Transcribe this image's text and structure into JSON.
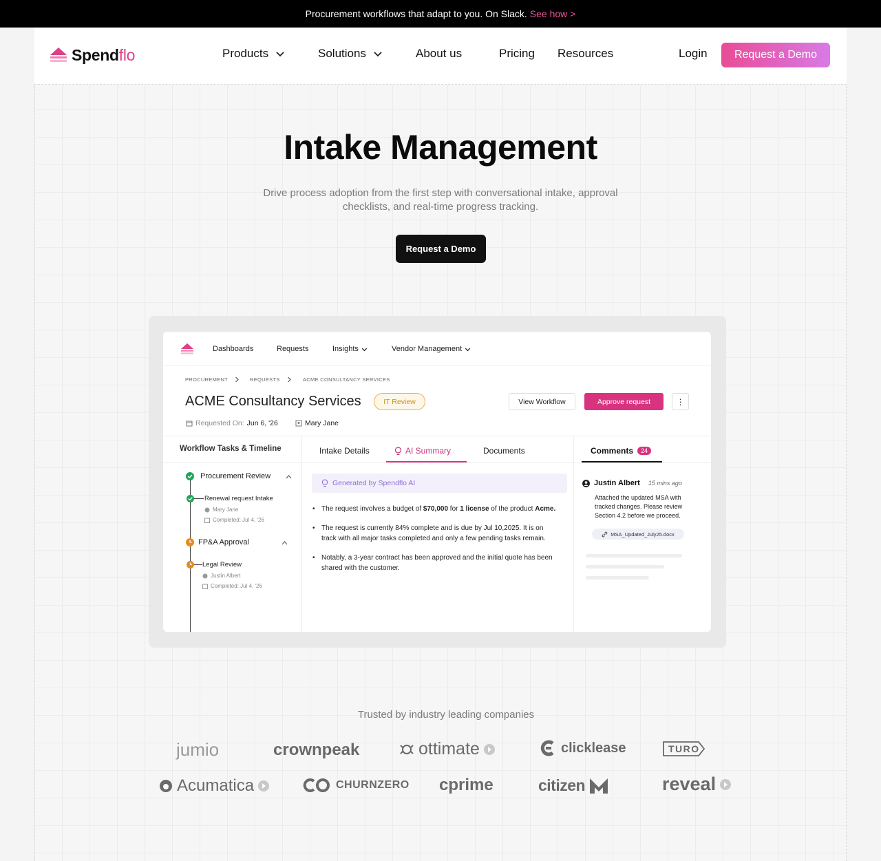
{
  "banner": {
    "text": "Procurement workflows that adapt to you. On Slack.",
    "link": "See how >"
  },
  "nav": {
    "logo_main": "Spend",
    "logo_accent": "flo",
    "items": [
      {
        "label": "Products"
      },
      {
        "label": "Solutions"
      },
      {
        "label": "About us"
      },
      {
        "label": "Pricing"
      },
      {
        "label": "Resources"
      }
    ],
    "login": "Login",
    "cta": "Request a Demo"
  },
  "hero": {
    "title": "Intake Management",
    "subtitle": "Drive process adoption from the first step with conversational intake, approval checklists, and real-time progress tracking.",
    "cta": "Request a Demo"
  },
  "mockup": {
    "nav": [
      "Dashboards",
      "Requests",
      "Insights",
      "Vendor Management"
    ],
    "breadcrumb": [
      "PROCUREMENT",
      "REQUESTS",
      "ACME CONSULTANCY SERVICES"
    ],
    "title": "ACME Consultancy Services",
    "status": "IT Review",
    "view_workflow": "View Workflow",
    "approve": "Approve request",
    "more": "⋮",
    "requested_label": "Requested On:",
    "requested_date": "Jun 6, '26",
    "requester": "Mary Jane",
    "workflow": {
      "heading": "Workflow Tasks & Timeline",
      "stages": [
        {
          "name": "Procurement Review",
          "task": "Renewal request Intake",
          "assignee": "Mary Jane",
          "completed": "Completed: Jul 4, '26"
        },
        {
          "name": "FP&A Approval",
          "task": "Legal Review",
          "assignee": "Justin Albert",
          "completed": "Completed: Jul 4, '26"
        }
      ]
    },
    "tabs": [
      "Intake Details",
      "AI Summary",
      "Documents"
    ],
    "generated_by": "Generated by Spendflo AI",
    "summary": {
      "b1_pre": "The request involves a budget of ",
      "b1_amount": "$70,000",
      "b1_mid": " for ",
      "b1_license": "1 license",
      "b1_post": " of the product ",
      "b1_product": "Acme.",
      "b2": "The request is currently 84% complete and is due by Jul 10,2025. It is on track with all major tasks completed and only a few pending tasks remain.",
      "b3": "Notably, a 3-year contract has been approved and the initial quote has been shared with the customer."
    },
    "comments": {
      "label": "Comments",
      "count": "24",
      "author": "Justin Albert",
      "time": "15 mins ago",
      "body": "Attached the updated MSA with tracked changes. Please review Section 4.2 before we proceed.",
      "file": "MSA_Updated_July25.docx"
    }
  },
  "trusted": {
    "heading": "Trusted by industry leading companies",
    "logos": [
      "jumio",
      "crownpeak",
      "ottimate",
      "clicklease",
      "TURO",
      "Acumatica",
      "CHURNZERO",
      "cprime",
      "citizen",
      "reveal"
    ]
  },
  "colors": {
    "brand_pink": "#d8337f",
    "cta_gradient_start": "#e94c96",
    "cta_gradient_end": "#d87ae6"
  }
}
